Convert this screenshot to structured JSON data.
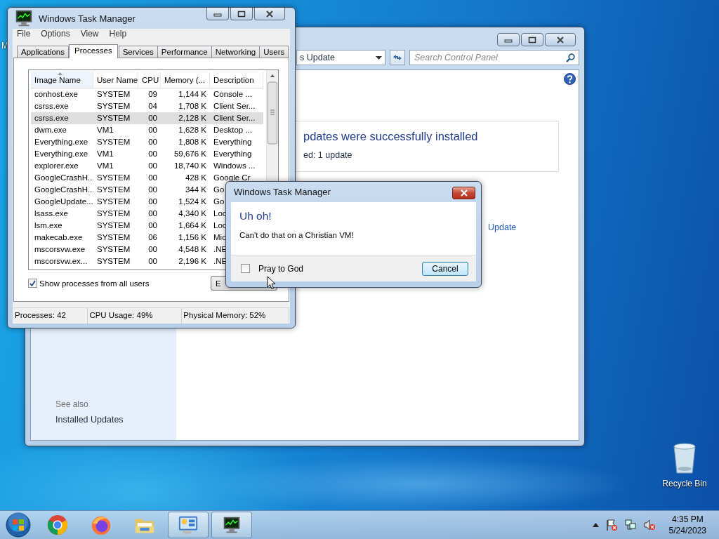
{
  "desktop_icons": [
    {
      "kind": "partial",
      "label": "M"
    },
    {
      "kind": "recycle-bin",
      "label": "Recycle Bin"
    }
  ],
  "control_panel": {
    "address": "s Update",
    "search": {
      "placeholder": "Search Control Panel"
    },
    "heading": "pdates were successfully installed",
    "summary": "ed: 1 update",
    "link": "Update",
    "see_also": {
      "title": "See also",
      "links": [
        "Installed Updates"
      ]
    }
  },
  "task_manager": {
    "title": "Windows Task Manager",
    "menu": [
      "File",
      "Options",
      "View",
      "Help"
    ],
    "tabs": [
      {
        "label": "Applications",
        "selected": false
      },
      {
        "label": "Processes",
        "selected": true
      },
      {
        "label": "Services",
        "selected": false
      },
      {
        "label": "Performance",
        "selected": false
      },
      {
        "label": "Networking",
        "selected": false
      },
      {
        "label": "Users",
        "selected": false
      }
    ],
    "table": {
      "columns": [
        "Image Name",
        "User Name",
        "CPU",
        "Memory (...",
        "Description"
      ],
      "rows": [
        {
          "cells": [
            "conhost.exe",
            "SYSTEM",
            "09",
            "1,144 K",
            "Console ..."
          ],
          "selected": false
        },
        {
          "cells": [
            "csrss.exe",
            "SYSTEM",
            "04",
            "1,708 K",
            "Client Ser..."
          ],
          "selected": false
        },
        {
          "cells": [
            "csrss.exe",
            "SYSTEM",
            "00",
            "2,128 K",
            "Client Ser..."
          ],
          "selected": true
        },
        {
          "cells": [
            "dwm.exe",
            "VM1",
            "00",
            "1,628 K",
            "Desktop ..."
          ],
          "selected": false
        },
        {
          "cells": [
            "Everything.exe",
            "SYSTEM",
            "00",
            "1,808 K",
            "Everything"
          ],
          "selected": false
        },
        {
          "cells": [
            "Everything.exe",
            "VM1",
            "00",
            "59,676 K",
            "Everything"
          ],
          "selected": false
        },
        {
          "cells": [
            "explorer.exe",
            "VM1",
            "00",
            "18,740 K",
            "Windows ..."
          ],
          "selected": false
        },
        {
          "cells": [
            "GoogleCrashH...",
            "SYSTEM",
            "00",
            "428 K",
            "Google Cr"
          ],
          "selected": false
        },
        {
          "cells": [
            "GoogleCrashH...",
            "SYSTEM",
            "00",
            "344 K",
            "Go"
          ],
          "selected": false
        },
        {
          "cells": [
            "GoogleUpdate...",
            "SYSTEM",
            "00",
            "1,524 K",
            "Go"
          ],
          "selected": false
        },
        {
          "cells": [
            "lsass.exe",
            "SYSTEM",
            "00",
            "4,340 K",
            "Loc"
          ],
          "selected": false
        },
        {
          "cells": [
            "lsm.exe",
            "SYSTEM",
            "00",
            "1,664 K",
            "Loc"
          ],
          "selected": false
        },
        {
          "cells": [
            "makecab.exe",
            "SYSTEM",
            "06",
            "1,156 K",
            "Mic"
          ],
          "selected": false
        },
        {
          "cells": [
            "mscorsvw.exe",
            "SYSTEM",
            "00",
            "4,548 K",
            ".NE"
          ],
          "selected": false
        },
        {
          "cells": [
            "mscorsvw.ex...",
            "SYSTEM",
            "00",
            "2,196 K",
            ".NE"
          ],
          "selected": false
        }
      ]
    },
    "show_all_users": {
      "label": "Show processes from all users",
      "checked": true
    },
    "end_button": "E",
    "status_bar": [
      "Processes: 42",
      "CPU Usage: 49%",
      "Physical Memory: 52%"
    ]
  },
  "dialog": {
    "title": "Windows Task Manager",
    "heading": "Uh oh!",
    "message": "Can't do that on a Christian VM!",
    "checkbox": {
      "label": "Pray to God",
      "checked": false
    },
    "buttons": [
      "Cancel"
    ]
  },
  "taskbar": {
    "apps": [
      {
        "kind": "chrome",
        "open": false
      },
      {
        "kind": "firefox",
        "open": false
      },
      {
        "kind": "folder",
        "open": false
      },
      {
        "kind": "control-panel",
        "open": true
      },
      {
        "kind": "task-manager",
        "open": true
      }
    ],
    "clock": {
      "time": "4:35 PM",
      "date": "5/24/2023"
    }
  }
}
